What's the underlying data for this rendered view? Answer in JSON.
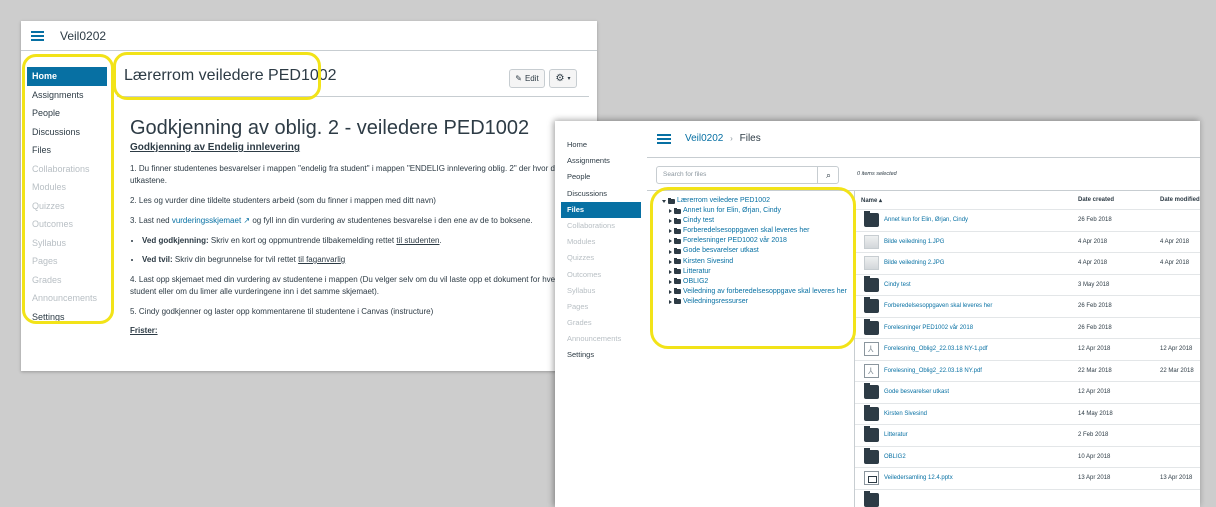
{
  "left": {
    "breadcrumb": "Veil0202",
    "nav": [
      {
        "label": "Home",
        "state": "active"
      },
      {
        "label": "Assignments",
        "state": "normal"
      },
      {
        "label": "People",
        "state": "normal"
      },
      {
        "label": "Discussions",
        "state": "normal"
      },
      {
        "label": "Files",
        "state": "normal"
      },
      {
        "label": "Collaborations",
        "state": "disabled"
      },
      {
        "label": "Modules",
        "state": "disabled"
      },
      {
        "label": "Quizzes",
        "state": "disabled"
      },
      {
        "label": "Outcomes",
        "state": "disabled"
      },
      {
        "label": "Syllabus",
        "state": "disabled"
      },
      {
        "label": "Pages",
        "state": "disabled"
      },
      {
        "label": "Grades",
        "state": "disabled"
      },
      {
        "label": "Announcements",
        "state": "disabled"
      },
      {
        "label": "Settings",
        "state": "normal"
      }
    ],
    "page_heading": "Lærerrom veiledere PED1002",
    "edit_label": "Edit",
    "title": "Godkjenning av oblig. 2 - veiledere PED1002",
    "subtitle": "Godkjenning av Endelig innlevering",
    "p1": "1. Du finner studentenes besvarelser i mappen \"endelig fra student\" i mappen \"ENDELIG innlevering oblig. 2\" der hvor du fant utkastene.",
    "p2": "2. Les og vurder dine tildelte studenters arbeid (som du finner i mappen med ditt navn)",
    "p3_a": "3. Last ned ",
    "p3_link": "vurderingsskjemaet",
    "p3_b": " og fyll inn din vurdering av studentenes besvarelse i den ene av de to boksene.",
    "b1_bold": "Ved godkjenning:",
    "b1_text": " Skriv en kort og oppmuntrende tilbakemelding rettet ",
    "b1_link": "til studenten",
    "b1_end": ".",
    "b2_bold": "Ved tvil:",
    "b2_text": " Skriv din begrunnelse for tvil rettet ",
    "b2_link": "til faganvarlig",
    "p4": "4. Last opp skjemaet med din vurdering av studentene i mappen (Du velger selv om du vil laste opp et dokument for hver student eller om du limer alle vurderingene inn i det samme skjemaet).",
    "p5": "5. Cindy godkjenner og laster opp kommentarene til studentene i Canvas (instructure)",
    "frister": "Frister:"
  },
  "right": {
    "breadcrumb_course": "Veil0202",
    "breadcrumb_sep": "›",
    "breadcrumb_page": "Files",
    "nav": [
      {
        "label": "Home",
        "state": "normal"
      },
      {
        "label": "Assignments",
        "state": "normal"
      },
      {
        "label": "People",
        "state": "normal"
      },
      {
        "label": "Discussions",
        "state": "normal"
      },
      {
        "label": "Files",
        "state": "active"
      },
      {
        "label": "Collaborations",
        "state": "disabled"
      },
      {
        "label": "Modules",
        "state": "disabled"
      },
      {
        "label": "Quizzes",
        "state": "disabled"
      },
      {
        "label": "Outcomes",
        "state": "disabled"
      },
      {
        "label": "Syllabus",
        "state": "disabled"
      },
      {
        "label": "Pages",
        "state": "disabled"
      },
      {
        "label": "Grades",
        "state": "disabled"
      },
      {
        "label": "Announcements",
        "state": "disabled"
      },
      {
        "label": "Settings",
        "state": "normal"
      }
    ],
    "search_placeholder": "Search for files",
    "selected_text": "0 items selected",
    "tree_root": "Lærerrom veiledere PED1002",
    "tree": [
      "Annet kun for Elin, Ørjan, Cindy",
      "Cindy test",
      "Forberedelsesoppgaven skal leveres her",
      "Forelesninger PED1002 vår 2018",
      "Gode besvarelser utkast",
      "Kirsten Sivesind",
      "Litteratur",
      "OBLIG2",
      "Veiledning av forberedelsesoppgave skal leveres her",
      "Veiledningsressurser"
    ],
    "columns": {
      "name": "Name ▴",
      "created": "Date created",
      "modified": "Date modified"
    },
    "files": [
      {
        "icon": "folder-icon",
        "name": "Annet kun for Elin, Ørjan, Cindy",
        "created": "26 Feb 2018",
        "modified": ""
      },
      {
        "icon": "image-icon",
        "name": "Bilde veiledning 1.JPG",
        "created": "4 Apr 2018",
        "modified": "4 Apr 2018"
      },
      {
        "icon": "image-icon",
        "name": "Bilde veiledning 2.JPG",
        "created": "4 Apr 2018",
        "modified": "4 Apr 2018"
      },
      {
        "icon": "folder-icon",
        "name": "Cindy test",
        "created": "3 May 2018",
        "modified": ""
      },
      {
        "icon": "folder-icon",
        "name": "Forberedelsesoppgaven skal leveres her",
        "created": "26 Feb 2018",
        "modified": ""
      },
      {
        "icon": "folder-icon",
        "name": "Forelesninger PED1002 vår 2018",
        "created": "26 Feb 2018",
        "modified": ""
      },
      {
        "icon": "pdf-icon",
        "name": "Forelesning_Oblig2_22.03.18 NY-1.pdf",
        "created": "12 Apr 2018",
        "modified": "12 Apr 2018"
      },
      {
        "icon": "pdf-icon",
        "name": "Forelesning_Oblig2_22.03.18 NY.pdf",
        "created": "22 Mar 2018",
        "modified": "22 Mar 2018"
      },
      {
        "icon": "folder-icon",
        "name": "Gode besvarelser utkast",
        "created": "12 Apr 2018",
        "modified": ""
      },
      {
        "icon": "folder-icon",
        "name": "Kirsten Sivesind",
        "created": "14 May 2018",
        "modified": ""
      },
      {
        "icon": "folder-icon",
        "name": "Litteratur",
        "created": "2 Feb 2018",
        "modified": ""
      },
      {
        "icon": "folder-icon",
        "name": "OBLIG2",
        "created": "10 Apr 2018",
        "modified": ""
      },
      {
        "icon": "pptx-icon",
        "name": "Veiledersamling 12.4.pptx",
        "created": "13 Apr 2018",
        "modified": "13 Apr 2018"
      },
      {
        "icon": "folder-icon",
        "name": "",
        "created": "",
        "modified": ""
      }
    ]
  },
  "colors": {
    "link": "#0770a3",
    "highlight": "#f2e318",
    "nav_active": "#0770a3"
  }
}
